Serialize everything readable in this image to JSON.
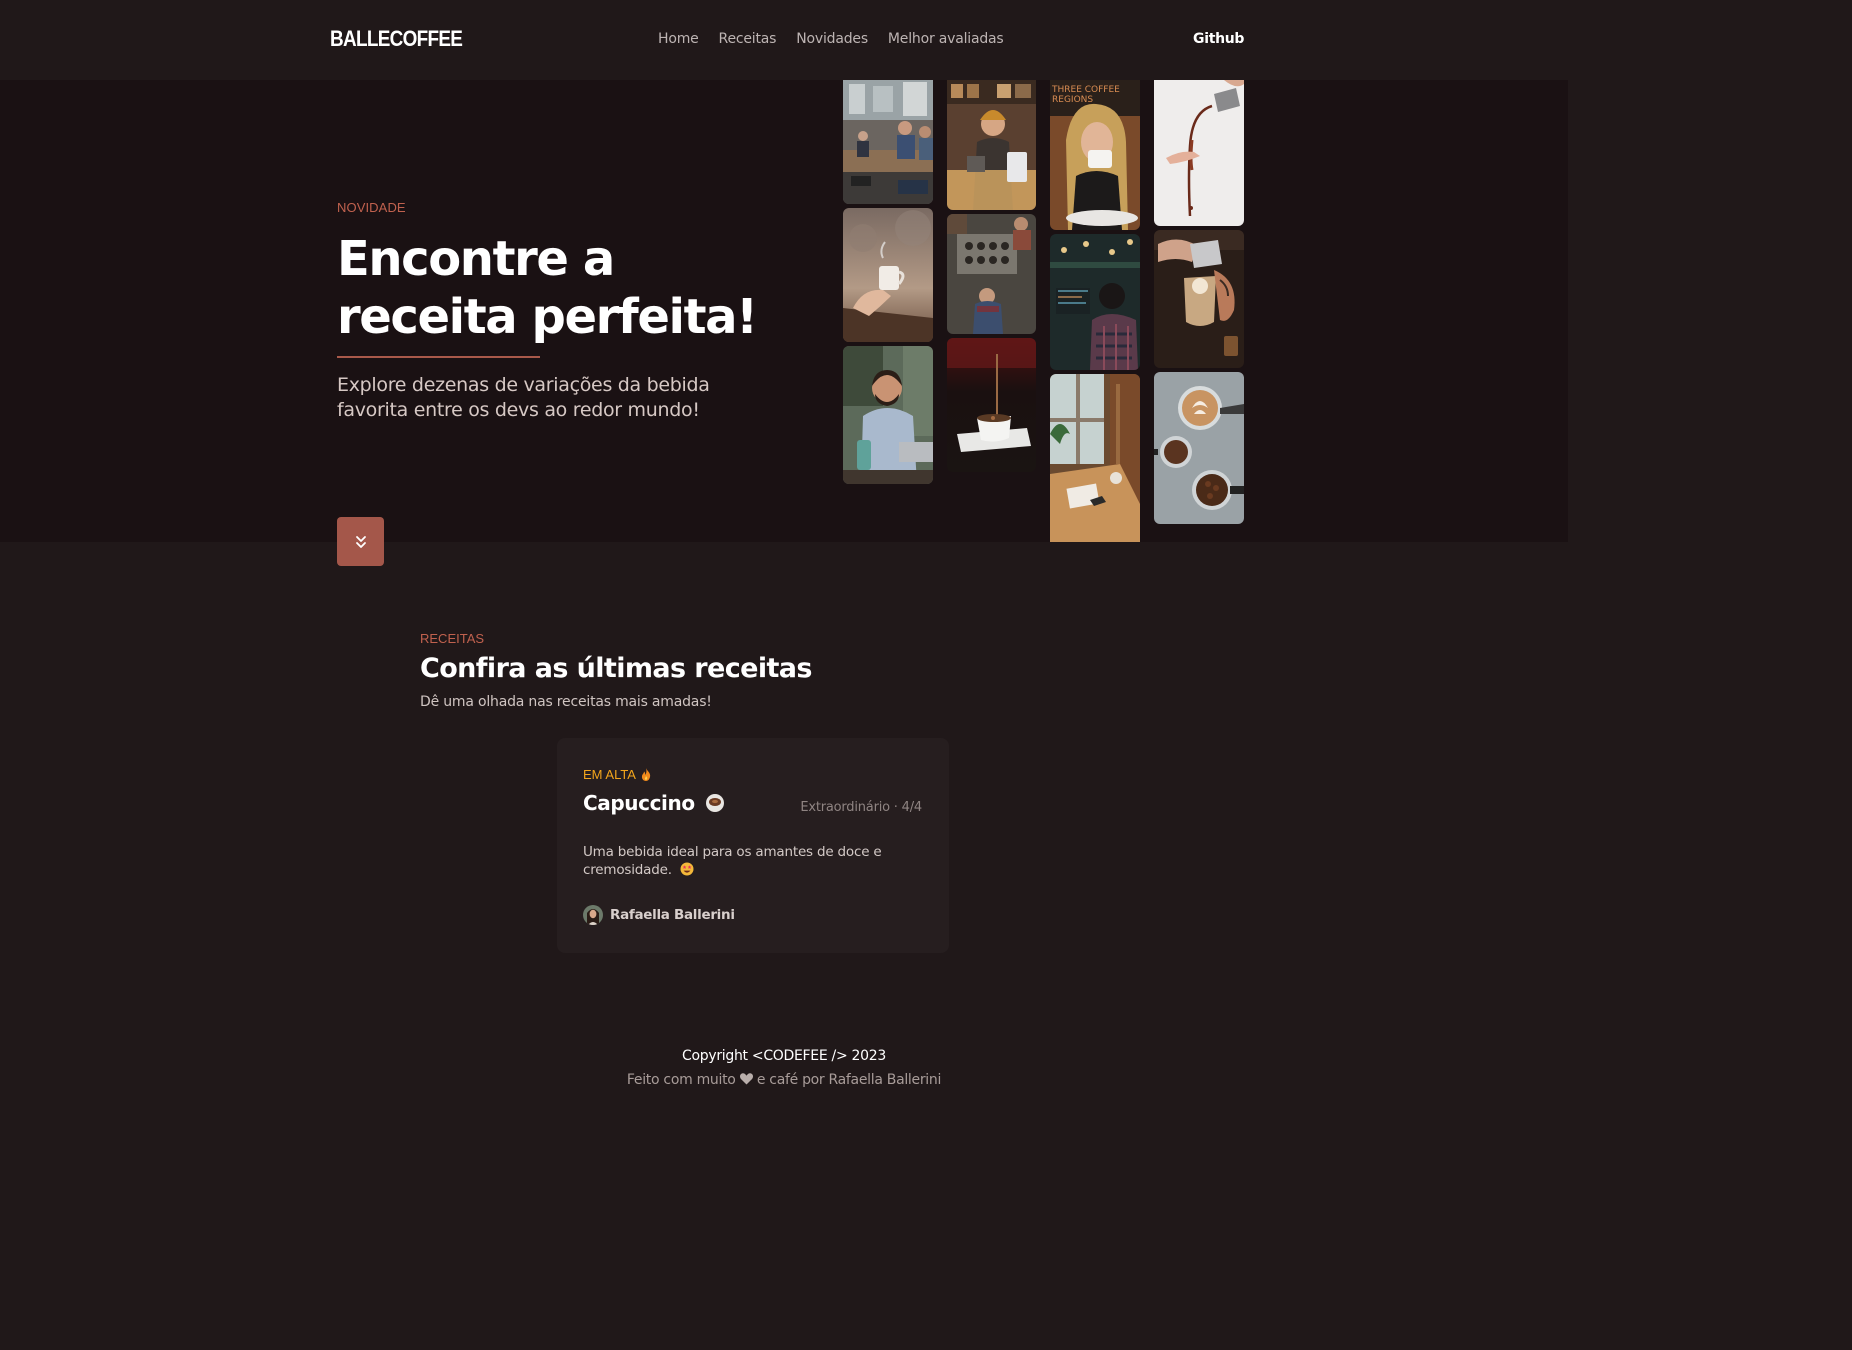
{
  "header": {
    "logo": "BALLECOFFEE",
    "nav": [
      {
        "label": "Home"
      },
      {
        "label": "Receitas"
      },
      {
        "label": "Novidades"
      },
      {
        "label": "Melhor avaliadas"
      }
    ],
    "github_label": "Github"
  },
  "hero": {
    "kicker": "NOVIDADE",
    "title": "Encontre a receita perfeita!",
    "subtitle": "Explore dezenas de variações da bebida favorita entre os devs ao redor mundo!",
    "scroll_icon": "double-chevron-down-icon",
    "accent_color": "#a4574a",
    "gallery": [
      "office-coworkers-photo",
      "barista-woman-photo",
      "woman-drinking-coffee-photo",
      "coffee-pouring-photo",
      "hand-holding-cup-photo",
      "coffee-shop-workers-photo",
      "man-coding-cafe-photo",
      "latte-art-pour-photo",
      "smiling-man-laptop-photo",
      "espresso-cup-photo",
      "cafe-table-window-photo",
      "espresso-portafilter-photo"
    ]
  },
  "recipes": {
    "kicker": "RECEITAS",
    "title": "Confira as últimas receitas",
    "subtitle": "Dê uma olhada nas receitas mais amadas!",
    "cards": [
      {
        "badge": "EM ALTA",
        "badge_icon": "fire-icon",
        "title": "Capuccino",
        "title_icon": "coffee-cup-icon",
        "meta": "Extraordinário · 4/4",
        "description": "Uma bebida ideal para os amantes de doce e cremosidade.",
        "desc_icon": "star-struck-emoji-icon",
        "author": "Rafaella Ballerini"
      }
    ]
  },
  "footer": {
    "copyright": "Copyright <CODEFEE /> 2023",
    "made_prefix": "Feito com muito",
    "made_suffix": "e café por Rafaella Ballerini"
  }
}
